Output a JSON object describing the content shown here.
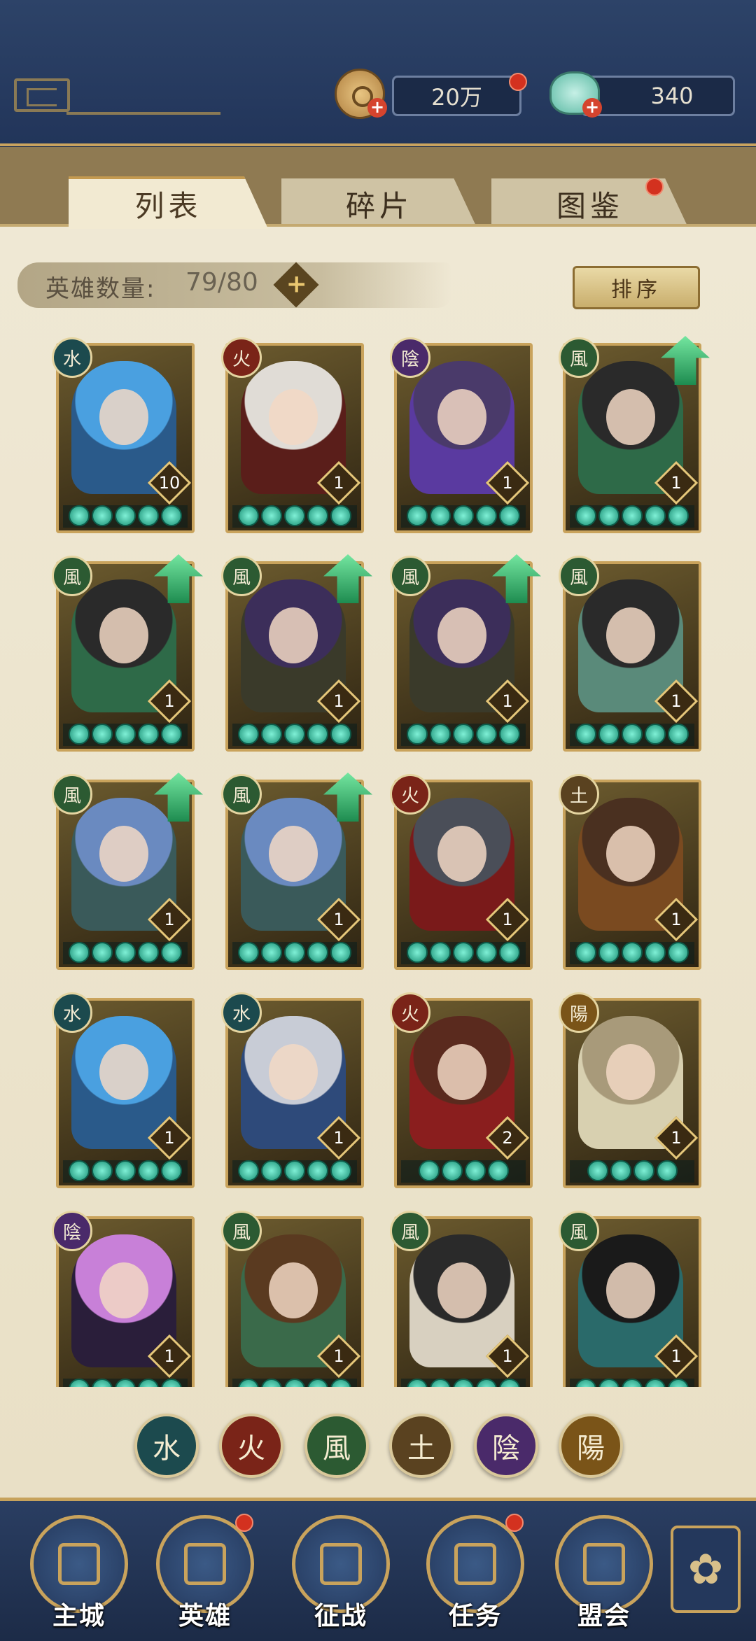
{
  "resources": {
    "coins": "20万",
    "gems": "340",
    "coin_icon": "copper-coin-icon",
    "gem_icon": "jade-pouch-icon"
  },
  "tabs": [
    {
      "label": "列表",
      "active": true
    },
    {
      "label": "碎片",
      "active": false
    },
    {
      "label": "图鉴",
      "active": false,
      "has_dot": true
    }
  ],
  "hero_count": {
    "label": "英雄数量:",
    "value": "79/80"
  },
  "sort_label": "排序",
  "heroes": [
    {
      "element": "水",
      "element_class": "water",
      "level": "10",
      "stars": 5,
      "upgrade": false,
      "hair": "#4aa0e0",
      "bg": "#2a5a8a"
    },
    {
      "element": "火",
      "element_class": "fire",
      "level": "1",
      "stars": 5,
      "upgrade": false,
      "hair": "#e0dcd6",
      "bg": "#5a1e1a"
    },
    {
      "element": "陰",
      "element_class": "yin",
      "level": "1",
      "stars": 5,
      "upgrade": false,
      "hair": "#4a3a6a",
      "bg": "#5a3aa0"
    },
    {
      "element": "風",
      "element_class": "wind",
      "level": "1",
      "stars": 5,
      "upgrade": true,
      "hair": "#2a2a2a",
      "bg": "#2e6a48"
    },
    {
      "element": "風",
      "element_class": "wind",
      "level": "1",
      "stars": 5,
      "upgrade": true,
      "hair": "#2a2a2a",
      "bg": "#2e6a48"
    },
    {
      "element": "風",
      "element_class": "wind",
      "level": "1",
      "stars": 5,
      "upgrade": true,
      "hair": "#3c2e5a",
      "bg": "#3a3a2a"
    },
    {
      "element": "風",
      "element_class": "wind",
      "level": "1",
      "stars": 5,
      "upgrade": true,
      "hair": "#3c2e5a",
      "bg": "#3a3a2a"
    },
    {
      "element": "風",
      "element_class": "wind",
      "level": "1",
      "stars": 5,
      "upgrade": false,
      "hair": "#2a2a2a",
      "bg": "#5a8a7a"
    },
    {
      "element": "風",
      "element_class": "wind",
      "level": "1",
      "stars": 5,
      "upgrade": true,
      "hair": "#6a8ac0",
      "bg": "#3a5a5a"
    },
    {
      "element": "風",
      "element_class": "wind",
      "level": "1",
      "stars": 5,
      "upgrade": true,
      "hair": "#6a8ac0",
      "bg": "#3a5a5a"
    },
    {
      "element": "火",
      "element_class": "fire",
      "level": "1",
      "stars": 5,
      "upgrade": false,
      "hair": "#4a4e58",
      "bg": "#7a1a1a"
    },
    {
      "element": "土",
      "element_class": "earth",
      "level": "1",
      "stars": 5,
      "upgrade": false,
      "hair": "#4a3020",
      "bg": "#7a4a20"
    },
    {
      "element": "水",
      "element_class": "water",
      "level": "1",
      "stars": 5,
      "upgrade": false,
      "hair": "#4aa0e0",
      "bg": "#2a5a8a"
    },
    {
      "element": "水",
      "element_class": "water",
      "level": "1",
      "stars": 5,
      "upgrade": false,
      "hair": "#c8ccd6",
      "bg": "#2e4a7a"
    },
    {
      "element": "火",
      "element_class": "fire",
      "level": "2",
      "stars": 4,
      "upgrade": false,
      "hair": "#5a2a1e",
      "bg": "#8a1e1e"
    },
    {
      "element": "陽",
      "element_class": "yang",
      "level": "1",
      "stars": 4,
      "upgrade": false,
      "hair": "#a89a7a",
      "bg": "#d8d0b0"
    },
    {
      "element": "陰",
      "element_class": "yin",
      "level": "1",
      "stars": 5,
      "upgrade": false,
      "hair": "#c880d8",
      "bg": "#2a1e3a"
    },
    {
      "element": "風",
      "element_class": "wind",
      "level": "1",
      "stars": 5,
      "upgrade": false,
      "hair": "#5a3a20",
      "bg": "#3a6a4a"
    },
    {
      "element": "風",
      "element_class": "wind",
      "level": "1",
      "stars": 5,
      "upgrade": false,
      "hair": "#2a2a2a",
      "bg": "#d8d0c0"
    },
    {
      "element": "風",
      "element_class": "wind",
      "level": "1",
      "stars": 5,
      "upgrade": false,
      "hair": "#1a1a1a",
      "bg": "#2a6a6a"
    }
  ],
  "element_filters": [
    {
      "glyph": "水",
      "class": "water"
    },
    {
      "glyph": "火",
      "class": "fire"
    },
    {
      "glyph": "風",
      "class": "wind"
    },
    {
      "glyph": "土",
      "class": "earth"
    },
    {
      "glyph": "陰",
      "class": "yin"
    },
    {
      "glyph": "陽",
      "class": "yang"
    }
  ],
  "nav": [
    {
      "label": "主城",
      "icon": "city-gate-icon",
      "dot": false
    },
    {
      "label": "英雄",
      "icon": "hero-portrait-icon",
      "dot": true
    },
    {
      "label": "征战",
      "icon": "battle-icon",
      "dot": false
    },
    {
      "label": "任务",
      "icon": "scroll-task-icon",
      "dot": true
    },
    {
      "label": "盟会",
      "icon": "alliance-icon",
      "dot": false
    }
  ],
  "more_icon": "flower-menu-icon"
}
